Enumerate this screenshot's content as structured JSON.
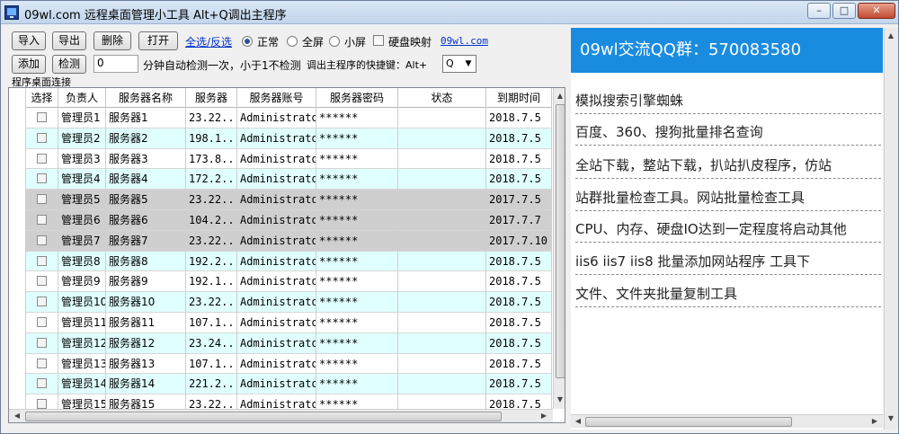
{
  "window": {
    "title": "09wl.com 远程桌面管理小工具 Alt+Q调出主程序"
  },
  "toolbar": {
    "import_label": "导入",
    "export_label": "导出",
    "delete_label": "删除",
    "open_label": "打开",
    "select_all_label": "全选/反选",
    "mode_normal": "正常",
    "mode_fullscreen": "全屏",
    "mode_small": "小屏",
    "disk_map_label": "硬盘映射",
    "site_link": "09wl.com",
    "add_label": "添加",
    "detect_label": "检测",
    "interval_value": "0",
    "interval_desc": "分钟自动检测一次，小于1不检测",
    "hotkey_desc": "调出主程序的快捷键：Alt+",
    "hotkey_value": "Q"
  },
  "group_label": "程序桌面连接",
  "table": {
    "headers": [
      "选择",
      "负责人",
      "服务器名称",
      "服务器",
      "服务器账号",
      "服务器密码",
      "状态",
      "到期时间"
    ],
    "rows": [
      {
        "owner": "管理员1",
        "name": "服务器1",
        "ip": "23.22...",
        "account": "Administrator",
        "password": "******",
        "status": "",
        "expire": "2018.7.5",
        "color": "white"
      },
      {
        "owner": "管理员2",
        "name": "服务器2",
        "ip": "198.1...",
        "account": "Administrator",
        "password": "******",
        "status": "",
        "expire": "2018.7.5",
        "color": "cyan"
      },
      {
        "owner": "管理员3",
        "name": "服务器3",
        "ip": "173.8...",
        "account": "Administrator",
        "password": "******",
        "status": "",
        "expire": "2018.7.5",
        "color": "white"
      },
      {
        "owner": "管理员4",
        "name": "服务器4",
        "ip": "172.2...",
        "account": "Administrator",
        "password": "******",
        "status": "",
        "expire": "2018.7.5",
        "color": "cyan"
      },
      {
        "owner": "管理员5",
        "name": "服务器5",
        "ip": "23.22...",
        "account": "Administrator",
        "password": "******",
        "status": "",
        "expire": "2017.7.5",
        "color": "gray"
      },
      {
        "owner": "管理员6",
        "name": "服务器6",
        "ip": "104.2...",
        "account": "Administrator",
        "password": "******",
        "status": "",
        "expire": "2017.7.7",
        "color": "gray"
      },
      {
        "owner": "管理员7",
        "name": "服务器7",
        "ip": "23.22...",
        "account": "Administrator",
        "password": "******",
        "status": "",
        "expire": "2017.7.10",
        "color": "gray"
      },
      {
        "owner": "管理员8",
        "name": "服务器8",
        "ip": "192.2...",
        "account": "Administrator",
        "password": "******",
        "status": "",
        "expire": "2018.7.5",
        "color": "cyan"
      },
      {
        "owner": "管理员9",
        "name": "服务器9",
        "ip": "192.1...",
        "account": "Administrator",
        "password": "******",
        "status": "",
        "expire": "2018.7.5",
        "color": "white"
      },
      {
        "owner": "管理员10",
        "name": "服务器10",
        "ip": "23.22...",
        "account": "Administrator",
        "password": "******",
        "status": "",
        "expire": "2018.7.5",
        "color": "cyan"
      },
      {
        "owner": "管理员11",
        "name": "服务器11",
        "ip": "107.1...",
        "account": "Administrator",
        "password": "******",
        "status": "",
        "expire": "2018.7.5",
        "color": "white"
      },
      {
        "owner": "管理员12",
        "name": "服务器12",
        "ip": "23.24...",
        "account": "Administrator",
        "password": "******",
        "status": "",
        "expire": "2018.7.5",
        "color": "cyan"
      },
      {
        "owner": "管理员13",
        "name": "服务器13",
        "ip": "107.1...",
        "account": "Administrator",
        "password": "******",
        "status": "",
        "expire": "2018.7.5",
        "color": "white"
      },
      {
        "owner": "管理员14",
        "name": "服务器14",
        "ip": "221.2...",
        "account": "Administrator",
        "password": "******",
        "status": "",
        "expire": "2018.7.5",
        "color": "cyan"
      },
      {
        "owner": "管理员15",
        "name": "服务器15",
        "ip": "23.22...",
        "account": "Administrator",
        "password": "******",
        "status": "",
        "expire": "2018.7.5",
        "color": "white"
      }
    ]
  },
  "row_colors": {
    "white": "#ffffff",
    "cyan": "#e0ffff",
    "gray": "#cfcfcf"
  },
  "sidebar": {
    "banner": "09wl交流QQ群：570083580",
    "banner_color": "#1a8ce0",
    "ads": [
      "模拟搜索引擎蜘蛛",
      "百度、360、搜狗批量排名查询",
      "全站下载，整站下载，扒站扒皮程序，仿站",
      "站群批量检查工具。网站批量检查工具",
      "CPU、内存、硬盘IO达到一定程度将启动其他",
      "iis6 iis7 iis8 批量添加网站程序 工具下",
      "文件、文件夹批量复制工具"
    ]
  }
}
